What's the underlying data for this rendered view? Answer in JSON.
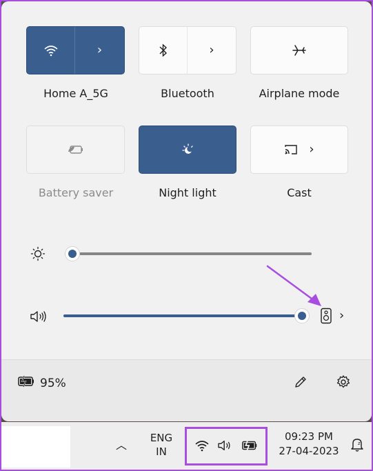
{
  "tiles": [
    {
      "label": "Home A_5G",
      "icon": "wifi-icon",
      "active": true,
      "split": true
    },
    {
      "label": "Bluetooth",
      "icon": "bluetooth-icon",
      "active": false,
      "split": true
    },
    {
      "label": "Airplane mode",
      "icon": "airplane-icon",
      "active": false,
      "split": false
    },
    {
      "label": "Battery saver",
      "icon": "battery-saver-icon",
      "active": false,
      "disabled": true
    },
    {
      "label": "Night light",
      "icon": "night-light-icon",
      "active": true
    },
    {
      "label": "Cast",
      "icon": "cast-icon",
      "active": false
    }
  ],
  "sliders": {
    "brightness": {
      "icon": "brightness-icon",
      "level": 0.03
    },
    "volume": {
      "icon": "speaker-icon",
      "level": 1.0,
      "output_icon": "speaker-device-icon"
    }
  },
  "status": {
    "battery_percent": "95%",
    "edit_icon": "pencil-icon",
    "settings_icon": "gear-icon"
  },
  "taskbar": {
    "lang_top": "ENG",
    "lang_bottom": "IN",
    "time": "09:23 PM",
    "date": "27-04-2023",
    "tray_icons": [
      "wifi-icon",
      "volume-icon",
      "battery-icon"
    ]
  },
  "colors": {
    "accent": "#3a5f8f",
    "highlight": "#a74ee0"
  }
}
